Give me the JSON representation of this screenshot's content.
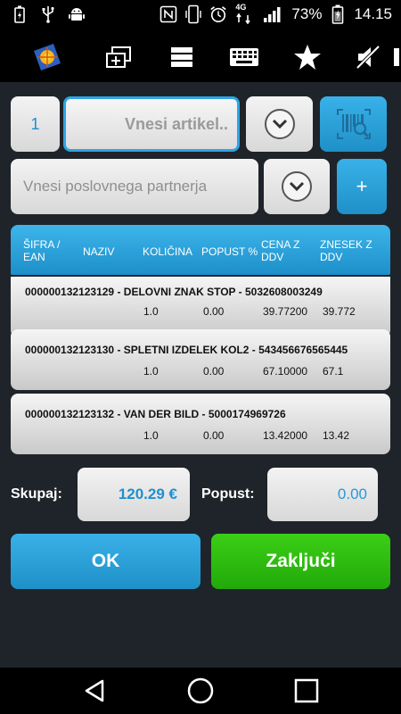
{
  "status_bar": {
    "battery": "73%",
    "time": "14.15",
    "network": "4G",
    "icons": [
      "battery-charging-icon",
      "usb-icon",
      "android-debug-icon",
      "nfc-icon",
      "phone-vibrate-icon",
      "alarm-icon",
      "signal-icon",
      "battery-icon"
    ]
  },
  "toolbar": {
    "icons": [
      "app-logo-icon",
      "add-window-icon",
      "list-icon",
      "keyboard-icon",
      "star-icon",
      "mute-icon"
    ]
  },
  "form": {
    "quantity": "1",
    "article_placeholder": "Vnesi artikel..",
    "partner_placeholder": "Vnesi poslovnega partnerja",
    "add_label": "+"
  },
  "table": {
    "headers": {
      "sifra": "ŠIFRA /",
      "ean": "EAN",
      "naziv": "NAZIV",
      "kolicina": "KOLIČINA",
      "popust": "POPUST %",
      "cena1": "CENA Z",
      "cena2": "DDV",
      "znesek1": "ZNESEK Z",
      "znesek2": "DDV"
    },
    "rows": [
      {
        "title": "000000132123129 - DELOVNI ZNAK STOP - 5032608003249",
        "qty": "1.0",
        "discount": "0.00",
        "price": "39.77200",
        "amount": "39.772"
      },
      {
        "title": "000000132123130 - SPLETNI IZDELEK KOL2 - 543456676565445",
        "qty": "1.0",
        "discount": "0.00",
        "price": "67.10000",
        "amount": "67.1"
      },
      {
        "title": "000000132123132 - VAN DER BILD - 5000174969726",
        "qty": "1.0",
        "discount": "0.00",
        "price": "13.42000",
        "amount": "13.42"
      }
    ]
  },
  "summary": {
    "total_label": "Skupaj:",
    "total_value": "120.29 €",
    "discount_label": "Popust:",
    "discount_value": "0.00"
  },
  "actions": {
    "ok_label": "OK",
    "finish_label": "Zaključi"
  },
  "colors": {
    "accent_blue": "#2ea4e4",
    "green": "#22a90a",
    "background": "#1f242a"
  }
}
